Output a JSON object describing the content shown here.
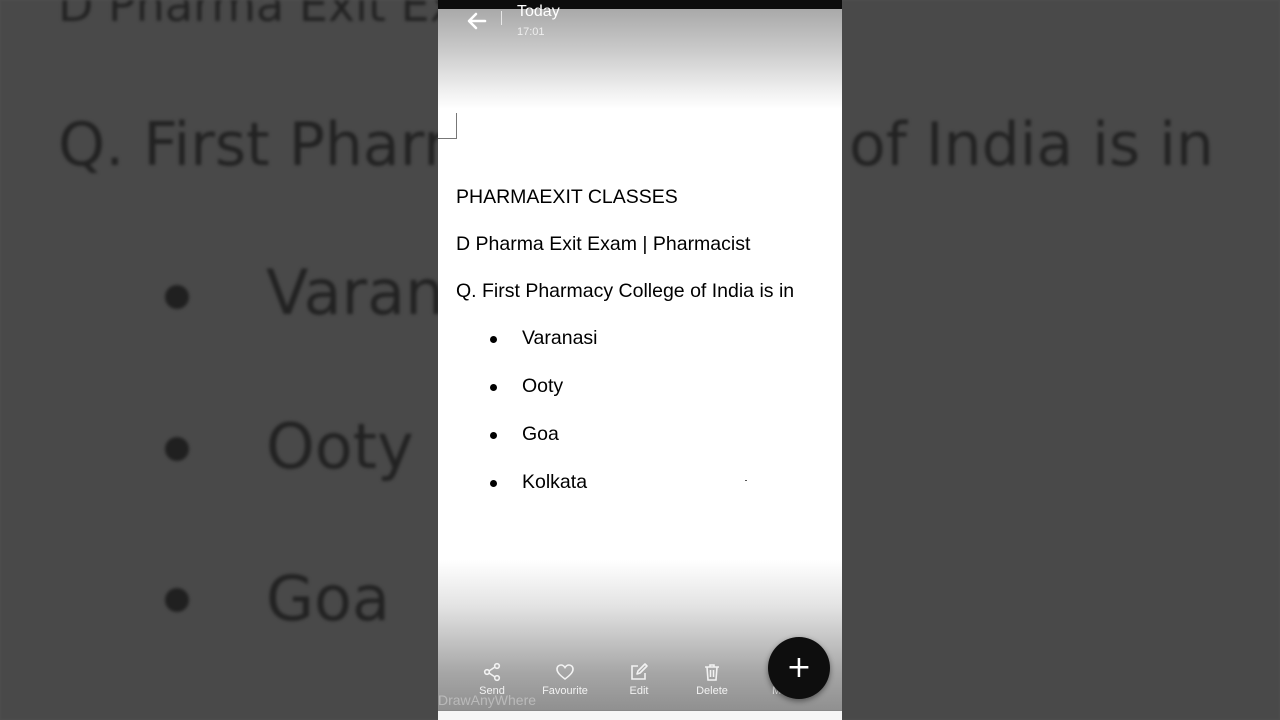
{
  "background": {
    "line1": "D Pharma Exit Exam | Pharmacist",
    "line2": "Q. First Pharmacy College of India is in",
    "items": [
      "Varanasi",
      "Ooty",
      "Goa"
    ]
  },
  "header": {
    "title": "Today",
    "time": "17:01",
    "back_icon": "back-arrow-icon"
  },
  "note": {
    "heading": "PHARMAEXIT CLASSES",
    "subtitle": "D Pharma Exit Exam | Pharmacist",
    "question": "Q. First Pharmacy College of India is in",
    "options": [
      "Varanasi",
      "Ooty",
      "Goa",
      "Kolkata"
    ]
  },
  "toolbar": {
    "send": {
      "label": "Send",
      "icon": "share-icon"
    },
    "favourite": {
      "label": "Favourite",
      "icon": "heart-icon"
    },
    "edit": {
      "label": "Edit",
      "icon": "edit-icon"
    },
    "delete": {
      "label": "Delete",
      "icon": "trash-icon"
    },
    "more": {
      "label": "M",
      "icon": "more-icon"
    },
    "add_icon": "+"
  },
  "watermark": "DrawAnyWhere",
  "colors": {
    "backdrop": "#505050",
    "fab": "#0e0e0e",
    "text": "#000000"
  }
}
